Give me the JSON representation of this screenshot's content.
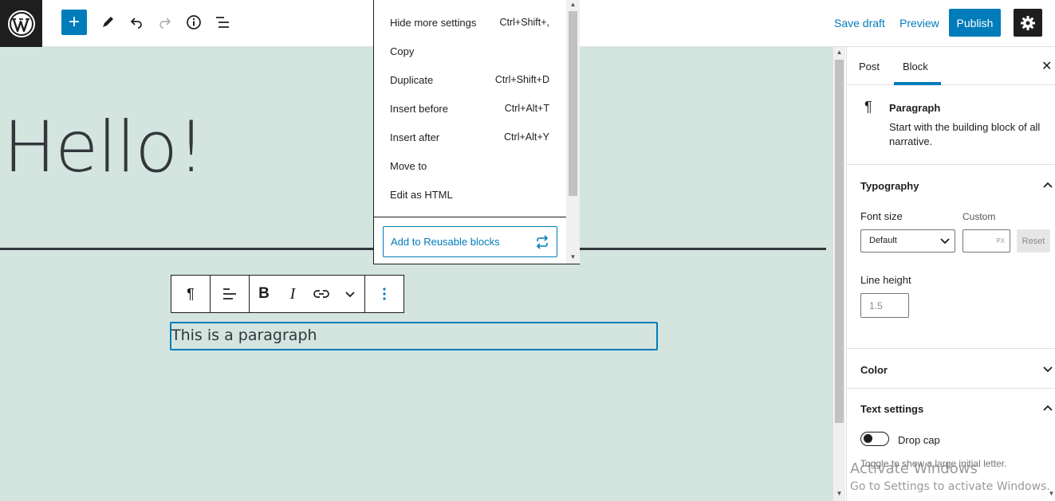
{
  "topbar": {
    "save_draft": "Save draft",
    "preview": "Preview",
    "publish": "Publish",
    "add_symbol": "+"
  },
  "canvas": {
    "heading": "Hello!",
    "paragraph": "This is a paragraph"
  },
  "menu": {
    "items": [
      {
        "label": "Hide more settings",
        "shortcut": "Ctrl+Shift+,"
      },
      {
        "label": "Copy",
        "shortcut": ""
      },
      {
        "label": "Duplicate",
        "shortcut": "Ctrl+Shift+D"
      },
      {
        "label": "Insert before",
        "shortcut": "Ctrl+Alt+T"
      },
      {
        "label": "Insert after",
        "shortcut": "Ctrl+Alt+Y"
      },
      {
        "label": "Move to",
        "shortcut": ""
      },
      {
        "label": "Edit as HTML",
        "shortcut": ""
      }
    ],
    "reusable": "Add to Reusable blocks"
  },
  "sidebar": {
    "tabs": [
      "Post",
      "Block"
    ],
    "active_tab": "Block",
    "block": {
      "title": "Paragraph",
      "description": "Start with the building block of all narrative."
    },
    "typography": {
      "title": "Typography",
      "font_size_label": "Font size",
      "custom_label": "Custom",
      "font_size_value": "Default",
      "custom_unit": "PX",
      "reset": "Reset",
      "line_height_label": "Line height",
      "line_height_placeholder": "1.5"
    },
    "color": {
      "title": "Color"
    },
    "text_settings": {
      "title": "Text settings",
      "drop_cap": "Drop cap",
      "help": "Toggle to show a large initial letter."
    }
  },
  "watermark": {
    "line1": "Activate Windows",
    "line2": "Go to Settings to activate Windows."
  },
  "colors": {
    "accent": "#007cba",
    "canvas_bg": "#d4e4df",
    "dark": "#1e1e1e"
  }
}
